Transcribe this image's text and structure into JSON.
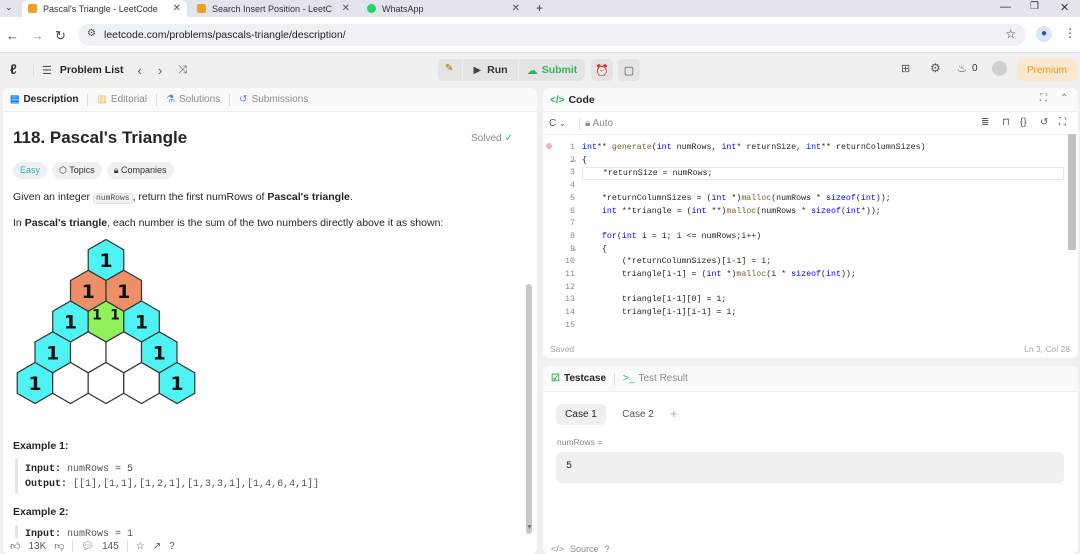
{
  "browser": {
    "tabs": [
      {
        "title": "Pascal's Triangle - LeetCode",
        "active": true
      },
      {
        "title": "Search Insert Position - LeetCode",
        "active": false
      },
      {
        "title": "WhatsApp",
        "active": false
      }
    ],
    "url": "leetcode.com/problems/pascals-triangle/description/"
  },
  "nav": {
    "problem_list": "Problem List",
    "run": "Run",
    "submit": "Submit",
    "fire_count": "0",
    "premium": "Premium"
  },
  "left_tabs": {
    "description": "Description",
    "editorial": "Editorial",
    "solutions": "Solutions",
    "submissions": "Submissions"
  },
  "problem": {
    "title": "118. Pascal's Triangle",
    "status": "Solved",
    "difficulty": "Easy",
    "topics": "Topics",
    "companies": "Companies",
    "para1_before": "Given an integer ",
    "para1_code": "numRows",
    "para1_after": ", return the first numRows of ",
    "para1_bold": "Pascal's triangle",
    "para1_end": ".",
    "para2_before": "In ",
    "para2_bold": "Pascal's triangle",
    "para2_after": ", each number is the sum of the two numbers directly above it as shown:",
    "example1_title": "Example 1:",
    "example1_input_label": "Input:",
    "example1_input": "numRows = 5",
    "example1_output_label": "Output:",
    "example1_output": "[[1],[1,1],[1,2,1],[1,3,3,1],[1,4,6,4,1]]",
    "example2_title": "Example 2:",
    "example2_input_label": "Input:",
    "example2_input": "numRows = 1"
  },
  "figure": {
    "hex_label": "1",
    "colors": {
      "cyan": "#4ff3f3",
      "orange": "#ef8f6a",
      "green": "#8ff25a",
      "white": "#ffffff"
    }
  },
  "footer_left": {
    "likes": "13K",
    "comments": "145"
  },
  "code_panel": {
    "title": "Code",
    "language": "C",
    "mode": "Auto",
    "saved": "Saved",
    "cursor": "Ln 3, Col 28",
    "lines": [
      {
        "n": "1",
        "text": "int** generate(int numRows, int* returnSize, int** returnColumnSizes)"
      },
      {
        "n": "2",
        "text": "{"
      },
      {
        "n": "3",
        "text": "    *returnSize = numRows;"
      },
      {
        "n": "4",
        "text": ""
      },
      {
        "n": "5",
        "text": "    *returnColumnSizes = (int *)malloc(numRows * sizeof(int));"
      },
      {
        "n": "6",
        "text": "    int **triangle = (int **)malloc(numRows * sizeof(int*));"
      },
      {
        "n": "7",
        "text": ""
      },
      {
        "n": "8",
        "text": "    for(int i = 1; i <= numRows;i++)"
      },
      {
        "n": "9",
        "text": "    {"
      },
      {
        "n": "10",
        "text": "        (*returnColumnSizes)[i-1] = i;"
      },
      {
        "n": "11",
        "text": "        triangle[i-1] = (int *)malloc(i * sizeof(int));"
      },
      {
        "n": "12",
        "text": ""
      },
      {
        "n": "13",
        "text": "        triangle[i-1][0] = 1;"
      },
      {
        "n": "14",
        "text": "        triangle[i-1][i-1] = 1;"
      },
      {
        "n": "15",
        "text": ""
      }
    ]
  },
  "test_panel": {
    "testcase_tab": "Testcase",
    "result_tab": "Test Result",
    "case1": "Case 1",
    "case2": "Case 2",
    "param_label": "numRows =",
    "param_value": "5",
    "source": "Source"
  }
}
